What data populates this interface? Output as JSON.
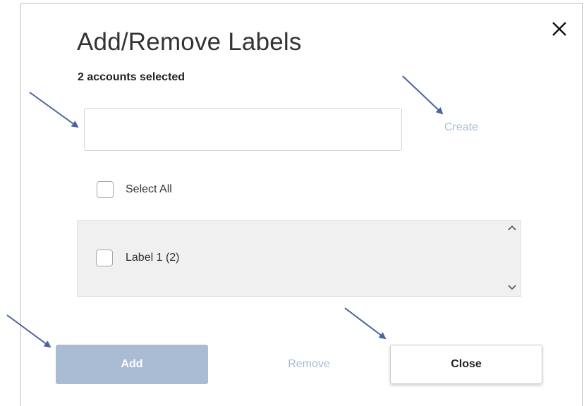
{
  "dialog": {
    "title": "Add/Remove Labels",
    "subtitle": "2 accounts selected",
    "close_icon": "close-icon"
  },
  "label_input": {
    "value": "",
    "placeholder": ""
  },
  "create_link": "Create",
  "select_all": {
    "label": "Select All",
    "checked": false
  },
  "labels": [
    {
      "label": "Label 1 (2)",
      "checked": false
    }
  ],
  "scrollbar": {
    "up_icon": "chevron-up-icon",
    "down_icon": "chevron-down-icon"
  },
  "buttons": {
    "add": "Add",
    "remove": "Remove",
    "close": "Close"
  },
  "colors": {
    "primary_disabled": "#a9bcd3",
    "annotation_arrow": "#4a62a0",
    "list_background": "#f0f0f0"
  },
  "annotations": {
    "arrow_icon": "arrow-icon",
    "count": 4
  }
}
